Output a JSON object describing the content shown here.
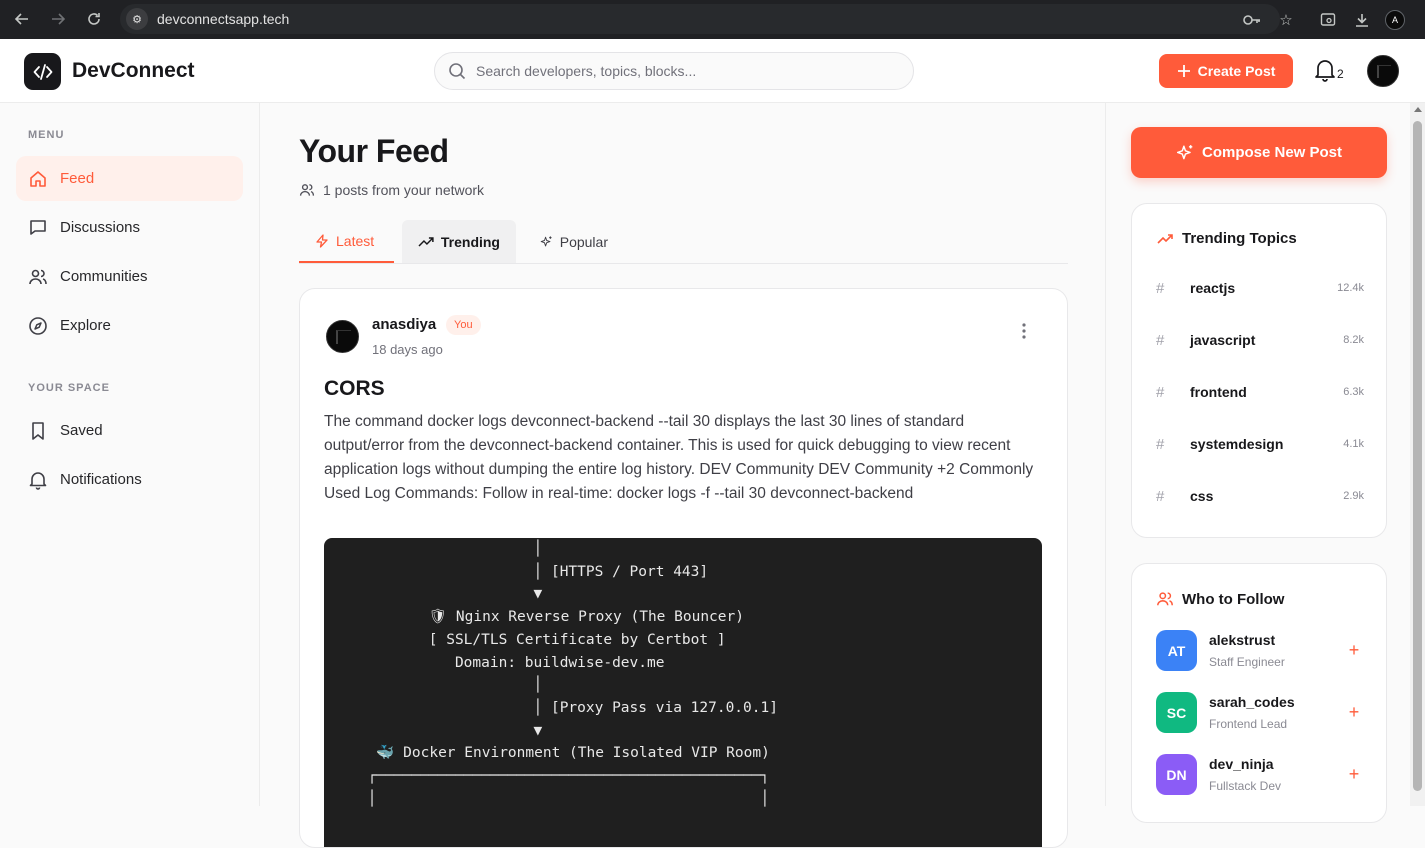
{
  "browser": {
    "url": "devconnectsapp.tech",
    "profile_initial": "A"
  },
  "header": {
    "brand": "DevConnect",
    "search_placeholder": "Search developers, topics, blocks...",
    "create_post_label": "Create Post",
    "notification_count": "2"
  },
  "sidebar": {
    "menu_label": "MENU",
    "menu_items": [
      {
        "label": "Feed",
        "icon": "home-icon",
        "active": true
      },
      {
        "label": "Discussions",
        "icon": "message-square-icon"
      },
      {
        "label": "Communities",
        "icon": "users-icon"
      },
      {
        "label": "Explore",
        "icon": "compass-icon"
      }
    ],
    "space_label": "YOUR SPACE",
    "space_items": [
      {
        "label": "Saved",
        "icon": "bookmark-icon"
      },
      {
        "label": "Notifications",
        "icon": "bell-icon"
      }
    ]
  },
  "feed": {
    "title": "Your Feed",
    "subtitle": "1 posts from your network",
    "tabs": [
      {
        "label": "Latest",
        "icon": "zap-icon",
        "active": true
      },
      {
        "label": "Trending",
        "icon": "trending-up-icon"
      },
      {
        "label": "Popular",
        "icon": "sparkles-icon"
      }
    ]
  },
  "post": {
    "author": "anasdiya",
    "badge": "You",
    "time": "18 days ago",
    "title": "CORS",
    "body": "The command docker logs devconnect-backend --tail 30 displays the last 30 lines of standard output/error from the devconnect-backend container. This is used for quick debugging to view recent application logs without dumping the entire log history. DEV Community DEV Community +2 Commonly Used Log Commands: Follow in real-time: docker logs -f --tail 30 devconnect-backend",
    "image_code": "                        │\n                        │ [HTTPS / Port 443]\n                        ▼\n            🛡 Nginx Reverse Proxy (The Bouncer)\n            [ SSL/TLS Certificate by Certbot ]\n               Domain: buildwise-dev.me\n                        │\n                        │ [Proxy Pass via 127.0.0.1]\n                        ▼\n      🐳 Docker Environment (The Isolated VIP Room)\n     ┌────────────────────────────────────────────┐\n     │                                            │"
  },
  "right": {
    "compose_label": "Compose New Post",
    "trending_title": "Trending Topics",
    "topics": [
      {
        "name": "reactjs",
        "count": "12.4k"
      },
      {
        "name": "javascript",
        "count": "8.2k"
      },
      {
        "name": "frontend",
        "count": "6.3k"
      },
      {
        "name": "systemdesign",
        "count": "4.1k"
      },
      {
        "name": "css",
        "count": "2.9k"
      }
    ],
    "follow_title": "Who to Follow",
    "follow": [
      {
        "initials": "AT",
        "name": "alekstrust",
        "role": "Staff Engineer",
        "color": "#3b82f6"
      },
      {
        "initials": "SC",
        "name": "sarah_codes",
        "role": "Frontend Lead",
        "color": "#10b981"
      },
      {
        "initials": "DN",
        "name": "dev_ninja",
        "role": "Fullstack Dev",
        "color": "#8b5cf6"
      }
    ]
  },
  "colors": {
    "accent": "#ff5b3a",
    "accent_soft": "#fff0eb"
  }
}
